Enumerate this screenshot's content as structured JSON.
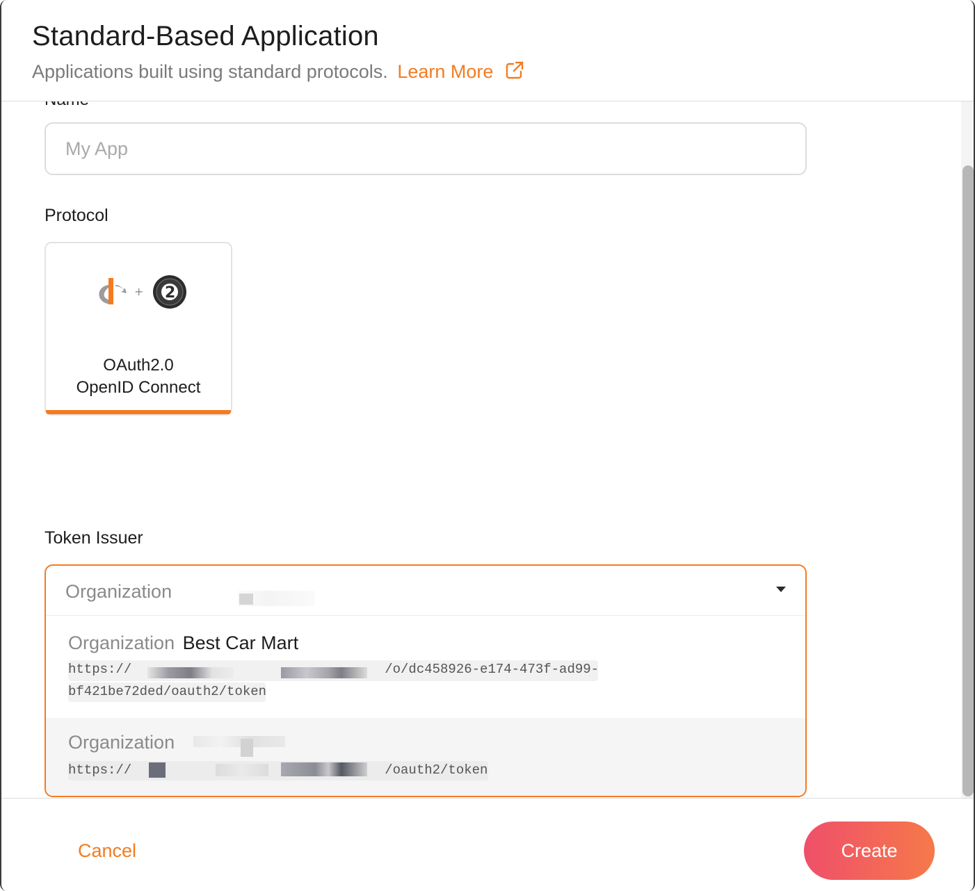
{
  "dialog": {
    "title": "Standard-Based Application",
    "subtitle": "Applications built using standard protocols.",
    "learn_more": "Learn More"
  },
  "name_field": {
    "label": "Name",
    "placeholder": "My App",
    "value": ""
  },
  "protocol": {
    "label": "Protocol",
    "options": [
      {
        "line1": "OAuth2.0",
        "line2": "OpenID Connect",
        "selected": true
      }
    ]
  },
  "token_issuer": {
    "label": "Token Issuer",
    "selected_prefix": "Organization",
    "options": [
      {
        "prefix": "Organization",
        "name": "Best Car Mart",
        "url_start": "https://",
        "url_end_line1": "/o/dc458926-e174-473f-ad99-",
        "url_line2": "bf421be72ded/oauth2/token"
      },
      {
        "prefix": "Organization",
        "name": "",
        "url_start": "https://",
        "url_end": "/oauth2/token"
      }
    ]
  },
  "footer": {
    "cancel_label": "Cancel",
    "create_label": "Create"
  },
  "colors": {
    "accent": "#f47b20",
    "create_gradient_start": "#ef4f6a",
    "create_gradient_end": "#f6794a"
  },
  "icons": {
    "learn_more": "external-link-icon",
    "dropdown": "caret-down-icon",
    "openid": "openid-logo",
    "oauth": "oauth2-logo"
  }
}
